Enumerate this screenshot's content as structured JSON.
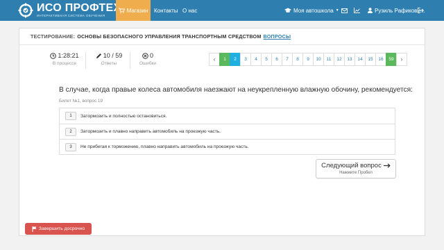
{
  "navbar": {
    "logo_title": "ИСО ПРОФТЕХ",
    "logo_subtitle": "ИНТЕРАКТИВНАЯ СИСТЕМА ОБУЧЕНИЯ",
    "shop_label": "Магазин",
    "contacts_label": "Контакты",
    "about_label": "О нас",
    "school_label": "Моя автошкола",
    "user_label": "Рузиль Рафикови..."
  },
  "header": {
    "label": "Тестирование:",
    "title": "Основы безопасного управления транспортным средством",
    "questions_link": "вопросы"
  },
  "stats": {
    "time_value": "1:28:21",
    "time_label": "В процессе",
    "answers_value": "10 / 59",
    "answers_label": "Ответы",
    "errors_value": "0",
    "errors_label": "Ошибки"
  },
  "pager": {
    "prev": "‹",
    "next": "›",
    "pages": [
      {
        "n": "1",
        "state": "ok"
      },
      {
        "n": "2",
        "state": "cur"
      },
      {
        "n": "3",
        "state": ""
      },
      {
        "n": "4",
        "state": ""
      },
      {
        "n": "5",
        "state": ""
      },
      {
        "n": "6",
        "state": ""
      },
      {
        "n": "7",
        "state": ""
      },
      {
        "n": "8",
        "state": ""
      },
      {
        "n": "9",
        "state": ""
      },
      {
        "n": "10",
        "state": ""
      },
      {
        "n": "11",
        "state": ""
      },
      {
        "n": "12",
        "state": ""
      },
      {
        "n": "13",
        "state": ""
      },
      {
        "n": "14",
        "state": ""
      },
      {
        "n": "15",
        "state": ""
      },
      {
        "n": "16",
        "state": ""
      },
      {
        "n": "59",
        "state": "ok"
      }
    ]
  },
  "question": {
    "text": "В случае, когда правые колеса автомобиля наезжают на неукрепленную влажную обочину, рекомендуется:",
    "ticket": "Билет №1, вопрос 19",
    "answers": [
      {
        "num": "1",
        "text": "Затормозить и полностью остановиться."
      },
      {
        "num": "2",
        "text": "Затормозить и плавно направить автомобиль на проезжую часть."
      },
      {
        "num": "3",
        "text": "Не прибегая к торможению, плавно направить автомобиль на проезжую часть."
      }
    ]
  },
  "next_button": {
    "label": "Следующий вопрос",
    "hint": "Нажмите Пробел"
  },
  "finish_button": {
    "label": "Завершить досрочно"
  },
  "colors": {
    "navbar": "#2e7fb0",
    "shop": "#f0ad4e",
    "success": "#5cb85c",
    "current": "#1fb0e0",
    "danger": "#d9534f"
  },
  "icons": {
    "logo": "gear-logo-icon",
    "shop": "cart-icon",
    "school": "graduation-cap-icon",
    "mail": "envelope-icon",
    "stats": "line-chart-icon",
    "user": "user-icon",
    "logout": "sign-out-icon",
    "time": "clock-icon",
    "answers": "pencil-icon",
    "errors": "x-circle-icon",
    "next": "arrow-right-icon",
    "finish": "flag-icon"
  }
}
